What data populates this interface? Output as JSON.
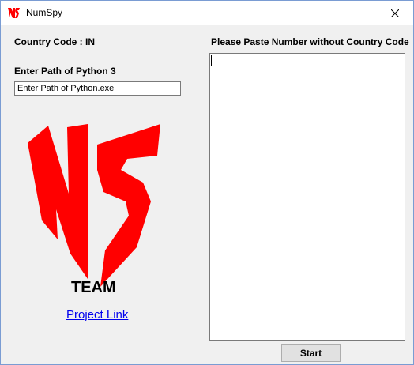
{
  "window": {
    "title": "NumSpy",
    "close_glyph": "✕",
    "app_icon": "ns-logo-icon"
  },
  "left_panel": {
    "country_code_label": "Country Code : IN",
    "python_path_label": "Enter Path of Python 3",
    "python_path_value": "Enter Path of Python.exe",
    "team_label": "TEAM",
    "project_link": "Project Link",
    "logo": "ns-logo-icon"
  },
  "right_panel": {
    "paste_label": "Please Paste Number without Country Code",
    "numbers_value": ""
  },
  "footer": {
    "start_label": "Start"
  },
  "colors": {
    "logo_red": "#ff0000",
    "link_blue": "#0000ee",
    "window_border": "#7a9cd3"
  }
}
